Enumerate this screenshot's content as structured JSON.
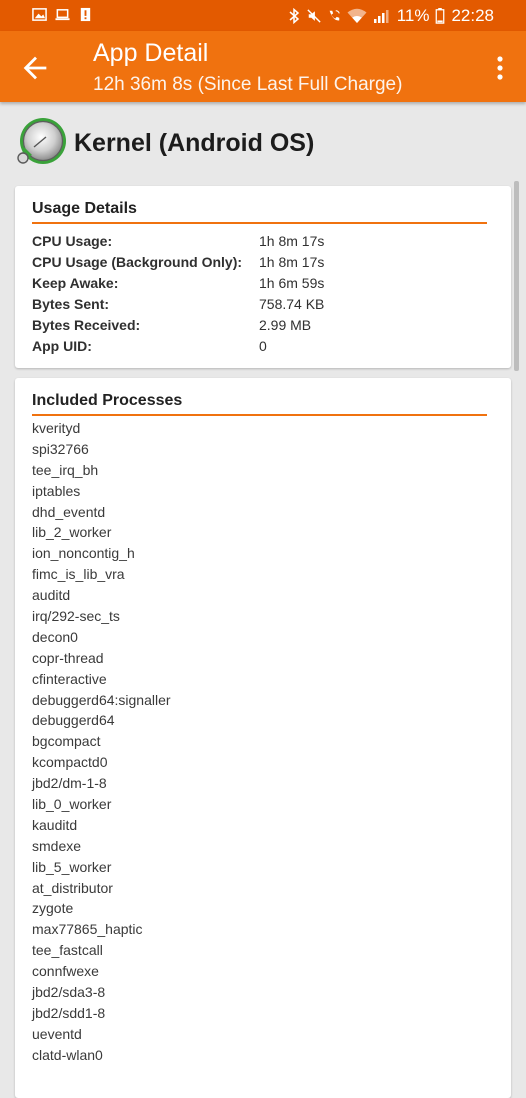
{
  "status_bar": {
    "battery_percent": "11%",
    "time": "22:28",
    "left_icons": [
      "image-icon",
      "laptop-icon",
      "alert-icon"
    ],
    "right_icons": [
      "bluetooth-icon",
      "mute-icon",
      "wifi-call-icon",
      "wifi-icon",
      "signal-icon",
      "battery-icon"
    ]
  },
  "app_bar": {
    "title": "App Detail",
    "subtitle": "12h 36m 8s (Since Last Full Charge)"
  },
  "app": {
    "name": "Kernel (Android OS)"
  },
  "usage_details": {
    "title": "Usage Details",
    "rows": [
      {
        "label": "CPU Usage:",
        "value": "1h 8m 17s"
      },
      {
        "label": "CPU Usage (Background Only):",
        "value": "1h 8m 17s"
      },
      {
        "label": "Keep Awake:",
        "value": "1h 6m 59s"
      },
      {
        "label": "Bytes Sent:",
        "value": "758.74 KB"
      },
      {
        "label": "Bytes Received:",
        "value": "2.99 MB"
      },
      {
        "label": "App UID:",
        "value": "0"
      }
    ]
  },
  "included_processes": {
    "title": "Included Processes",
    "items": [
      "kverityd",
      "spi32766",
      "tee_irq_bh",
      "iptables",
      "dhd_eventd",
      "lib_2_worker",
      "ion_noncontig_h",
      "fimc_is_lib_vra",
      "auditd",
      "irq/292-sec_ts",
      "decon0",
      "copr-thread",
      "cfinteractive",
      "debuggerd64:signaller",
      "debuggerd64",
      "bgcompact",
      "kcompactd0",
      "jbd2/dm-1-8",
      "lib_0_worker",
      "kauditd",
      "smdexe",
      "lib_5_worker",
      "at_distributor",
      "zygote",
      "max77865_haptic",
      "tee_fastcall",
      "connfwexe",
      "jbd2/sda3-8",
      "jbd2/sdd1-8",
      "ueventd",
      "clatd-wlan0"
    ]
  },
  "colors": {
    "status_bar": "#e35a00",
    "app_bar": "#f0720f",
    "accent_rule": "#f0720f",
    "background": "#e8e8e8"
  }
}
